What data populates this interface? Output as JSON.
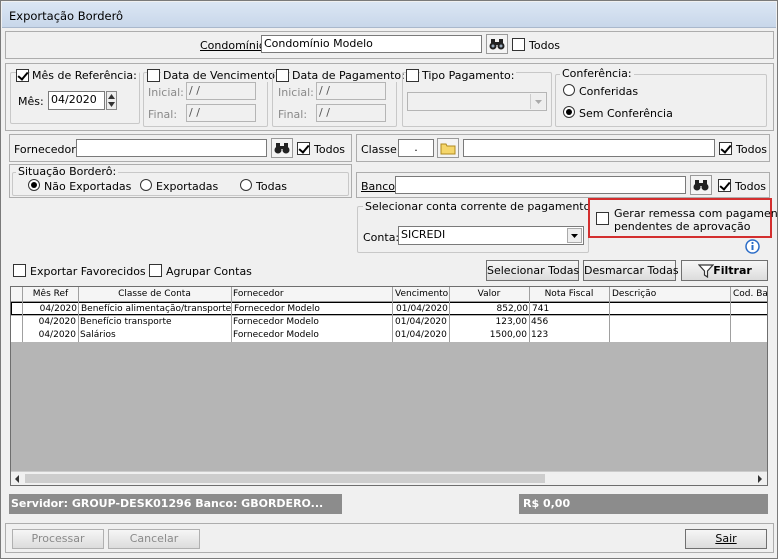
{
  "window": {
    "title": "Exportação Borderô"
  },
  "condominio": {
    "label": "Condomínio:",
    "value": "Condomínio Modelo",
    "todos_label": "Todos",
    "todos_checked": false
  },
  "mes_referencia": {
    "label": "Mês de Referência:",
    "checked": true,
    "mes_label": "Mês:",
    "value": "04/2020"
  },
  "data_vencimento": {
    "label": "Data de Vencimento:",
    "checked": false,
    "inicial_label": "Inicial:",
    "inicial_value": " / /",
    "final_label": "Final:",
    "final_value": " / /"
  },
  "data_pagamento": {
    "label": "Data de Pagamento:",
    "checked": false,
    "inicial_label": "Inicial:",
    "inicial_value": " / /",
    "final_label": "Final:",
    "final_value": " / /"
  },
  "tipo_pagamento": {
    "label": "Tipo Pagamento:",
    "checked": false,
    "value": ""
  },
  "conferencia": {
    "label": "Conferência:",
    "options": [
      "Conferidas",
      "Sem Conferência"
    ],
    "selected": "Sem Conferência"
  },
  "fornecedor": {
    "label": "Fornecedor:",
    "value": "",
    "todos_label": "Todos",
    "todos_checked": true
  },
  "classe": {
    "label": "Classe:",
    "code": ".",
    "value": "",
    "todos_label": "Todos",
    "todos_checked": true
  },
  "situacao": {
    "label": "Situação Borderô:",
    "options": [
      "Não Exportadas",
      "Exportadas",
      "Todas"
    ],
    "selected": "Não Exportadas"
  },
  "banco": {
    "label": "Banco:",
    "value": "",
    "todos_label": "Todos",
    "todos_checked": true
  },
  "conta_corrente": {
    "label": "Selecionar conta corrente de pagamento",
    "conta_label": "Conta:",
    "value": "SICREDI"
  },
  "gerar_remessa": {
    "label_line1": "Gerar remessa com pagamentos",
    "label_line2": "pendentes de aprovação",
    "checked": false,
    "highlight_color": "#d32f2f"
  },
  "options": {
    "exportar_favorecidos": "Exportar Favorecidos",
    "agrupar_contas": "Agrupar Contas"
  },
  "actions": {
    "selecionar_todas": "Selecionar Todas",
    "desmarcar_todas": "Desmarcar Todas",
    "filtrar": "Filtrar"
  },
  "table": {
    "columns": [
      "Mês Ref",
      "Classe de Conta",
      "Fornecedor",
      "Vencimento",
      "Valor",
      "Nota Fiscal",
      "Descrição",
      "Cod. Ba"
    ],
    "rows": [
      [
        "04/2020",
        "Benefício alimentação/transporte",
        "Fornecedor Modelo",
        "01/04/2020",
        "852,00",
        "741",
        "",
        ""
      ],
      [
        "04/2020",
        "Benefício transporte",
        "Fornecedor Modelo",
        "01/04/2020",
        "123,00",
        "456",
        "",
        ""
      ],
      [
        "04/2020",
        "Salários",
        "Fornecedor Modelo",
        "01/04/2020",
        "1500,00",
        "123",
        "",
        ""
      ]
    ]
  },
  "statusbar": {
    "server": "Servidor: GROUP-DESK01296 Banco: GBORDERO...",
    "total": "R$ 0,00"
  },
  "footer": {
    "processar": "Processar",
    "cancelar": "Cancelar",
    "sair": "Sair"
  }
}
